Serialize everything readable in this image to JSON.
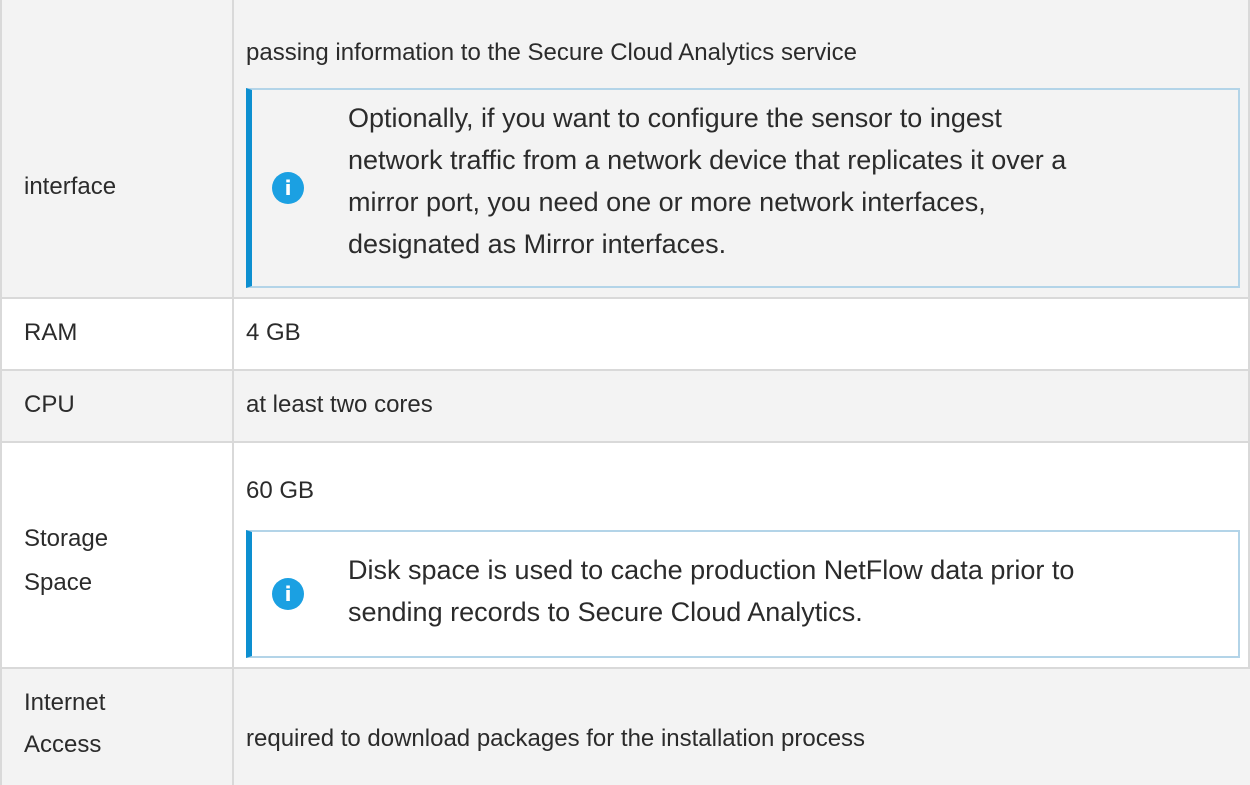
{
  "rows": [
    {
      "label": "interface",
      "value": "passing information to the Secure Cloud Analytics service",
      "note": {
        "icon": "info-icon",
        "lines": [
          "Optionally, if you want to configure the sensor to ingest",
          "network traffic from a network device that replicates it over a",
          "mirror port, you need one or more network interfaces,",
          "designated as Mirror interfaces."
        ]
      }
    },
    {
      "label": "RAM",
      "value": "4 GB"
    },
    {
      "label": "CPU",
      "value": "at least two cores"
    },
    {
      "label_lines": [
        "Storage",
        "Space"
      ],
      "value": "60 GB",
      "note": {
        "icon": "info-icon",
        "lines": [
          "Disk space is used to cache production NetFlow data prior to",
          "sending records to Secure Cloud Analytics."
        ]
      }
    },
    {
      "label_lines": [
        "Internet",
        "Access"
      ],
      "value": "required to download packages for the installation process"
    }
  ],
  "colors": {
    "note_accent": "#0d8fd0",
    "note_border": "#b3d4e8",
    "icon_fill": "#1ba0e2",
    "row_alt": "#f3f3f3",
    "grid": "#d9d9d9"
  }
}
